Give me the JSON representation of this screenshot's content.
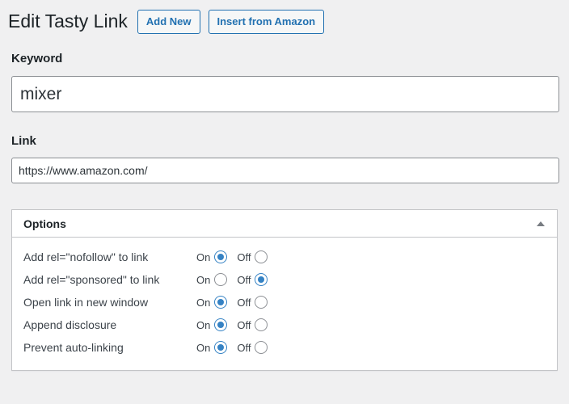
{
  "header": {
    "title": "Edit Tasty Link",
    "buttons": [
      {
        "label": "Add New",
        "name": "add-new-button"
      },
      {
        "label": "Insert from Amazon",
        "name": "insert-from-amazon-button"
      }
    ]
  },
  "fields": {
    "keyword": {
      "label": "Keyword",
      "value": "mixer",
      "placeholder": ""
    },
    "link": {
      "label": "Link",
      "value": "https://www.amazon.com/",
      "placeholder": ""
    }
  },
  "options_panel": {
    "title": "Options",
    "toggle_icon": "caret-up-icon",
    "on_label": "On",
    "off_label": "Off",
    "rows": [
      {
        "label": "Add rel=\"nofollow\" to link",
        "value": "On"
      },
      {
        "label": "Add rel=\"sponsored\" to link",
        "value": "Off"
      },
      {
        "label": "Open link in new window",
        "value": "On"
      },
      {
        "label": "Append disclosure",
        "value": "On"
      },
      {
        "label": "Prevent auto-linking",
        "value": "On"
      }
    ]
  },
  "colors": {
    "page_background": "#f0f0f1",
    "accent_blue": "#2271b1",
    "radio_blue": "#3582c4",
    "border_gray": "#c3c4c7",
    "input_border": "#8c8f94",
    "text_dark": "#1d2327",
    "text_body": "#3c434a"
  }
}
